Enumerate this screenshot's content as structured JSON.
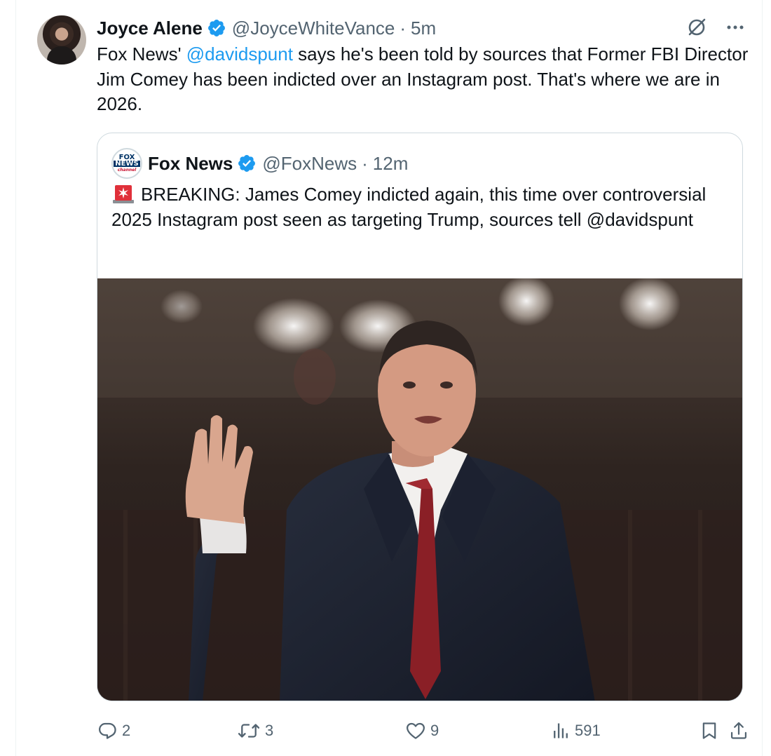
{
  "tweet": {
    "author_name": "Joyce Alene",
    "author_handle": "@JoyceWhiteVance",
    "separator": "·",
    "time": "5m",
    "text_before": "Fox News' ",
    "mention": "@davidspunt",
    "text_after": " says he's been told by sources that Former FBI Director Jim Comey has been indicted over an Instagram post. That's where we are in 2026.",
    "verified": true
  },
  "quoted_tweet": {
    "author_name": "Fox News",
    "author_handle": "@FoxNews",
    "separator": "·",
    "time": "12m",
    "logo_text": [
      "FOX",
      "NEWS",
      "channel"
    ],
    "text": "BREAKING: James Comey indicted again, this time over controversial 2025 Instagram post seen as targeting Trump, sources tell @davidspunt",
    "verified": true,
    "emoji": "police-car-light-emoji"
  },
  "actions": {
    "replies": "2",
    "reposts": "3",
    "likes": "9",
    "views": "591"
  },
  "icons": [
    "grok-icon",
    "more-icon",
    "verified-badge-icon",
    "reply-icon",
    "repost-icon",
    "like-icon",
    "views-icon",
    "bookmark-icon",
    "share-icon"
  ],
  "colors": {
    "accent": "#1d9bf0",
    "text": "#0f1419",
    "secondary": "#536471",
    "border": "#cfd9de"
  }
}
